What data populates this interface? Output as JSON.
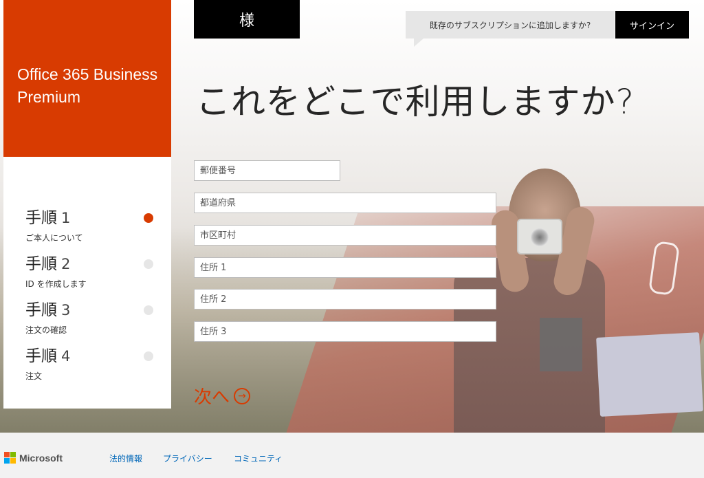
{
  "header": {
    "name_suffix": "様",
    "existing_subscription_prompt": "既存のサブスクリプションに追加しますか?",
    "signin_label": "サインイン"
  },
  "brand": {
    "product_line1": "Office 365 Business",
    "product_line2": "Premium",
    "brand_color": "#d83b01"
  },
  "steps": [
    {
      "title": "手順",
      "number": "1",
      "subtitle": "ご本人について",
      "active": true
    },
    {
      "title": "手順",
      "number": "2",
      "subtitle": "ID を作成します",
      "active": false
    },
    {
      "title": "手順",
      "number": "3",
      "subtitle": "注文の確認",
      "active": false
    },
    {
      "title": "手順",
      "number": "4",
      "subtitle": "注文",
      "active": false
    }
  ],
  "main": {
    "question": "これをどこで利用しますか?",
    "fields": {
      "postal_code": {
        "placeholder": "郵便番号",
        "value": ""
      },
      "prefecture": {
        "placeholder": "都道府県",
        "value": ""
      },
      "city": {
        "placeholder": "市区町村",
        "value": ""
      },
      "address1": {
        "placeholder": "住所 1",
        "value": ""
      },
      "address2": {
        "placeholder": "住所 2",
        "value": ""
      },
      "address3": {
        "placeholder": "住所 3",
        "value": ""
      }
    },
    "next_label": "次へ",
    "next_icon": "arrow-circle-right-icon"
  },
  "footer": {
    "company": "Microsoft",
    "links": {
      "legal": "法的情報",
      "privacy": "プライバシー",
      "community": "コミュニティ"
    },
    "logo_colors": [
      "#f25022",
      "#7fba00",
      "#00a4ef",
      "#ffb900"
    ]
  }
}
